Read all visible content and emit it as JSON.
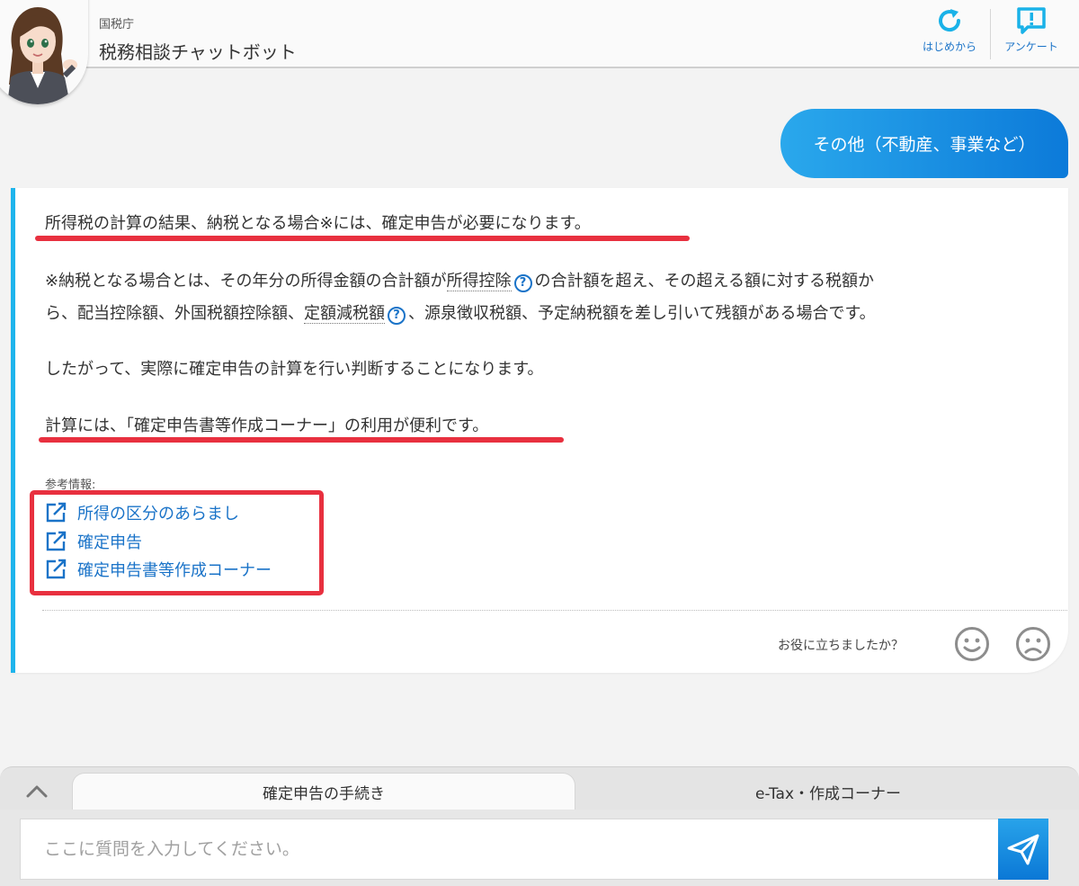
{
  "header": {
    "agency": "国税庁",
    "title": "税務相談チャットボット",
    "restart_label": "はじめから",
    "survey_label": "アンケート"
  },
  "user_message": "その他（不動産、事業など）",
  "bot_answer": {
    "line1": "所得税の計算の結果、納税となる場合※には、確定申告が必要になります。",
    "note_part1": "※納税となる場合とは、その年分の所得金額の合計額が",
    "term1": "所得控除",
    "note_part2": "の合計額を超え、その超える額に対する税額か",
    "note_part3": "ら、配当控除額、外国税額控除額、",
    "term2": "定額減税額",
    "note_part4": "、源泉徴収税額、予定納税額を差し引いて残額がある場合です。",
    "line3": "したがって、実際に確定申告の計算を行い判断することになります。",
    "line4": "計算には、「確定申告書等作成コーナー」の利用が便利です。",
    "help_glyph": "?",
    "reference_label": "参考情報:",
    "links": [
      {
        "label": "所得の区分のあらまし"
      },
      {
        "label": "確定申告"
      },
      {
        "label": "確定申告書等作成コーナー"
      }
    ],
    "feedback_question": "お役に立ちましたか？"
  },
  "bottom": {
    "tabs": [
      {
        "label": "確定申告の手続き"
      },
      {
        "label": "e-Tax・作成コーナー"
      }
    ],
    "input_placeholder": "ここに質問を入力してください。"
  },
  "colors": {
    "accent_blue": "#1a73c8",
    "bubble_start": "#2aa8ec",
    "bubble_end": "#0c7ad9",
    "annotation_red": "#e8303f",
    "card_border": "#1eb4ec"
  },
  "icons": {
    "restart": "refresh-icon",
    "survey": "survey-icon",
    "link": "external-link-icon",
    "help": "help-icon",
    "good": "smile-icon",
    "bad": "frown-icon",
    "collapse": "chevron-up-icon",
    "send": "send-icon"
  }
}
